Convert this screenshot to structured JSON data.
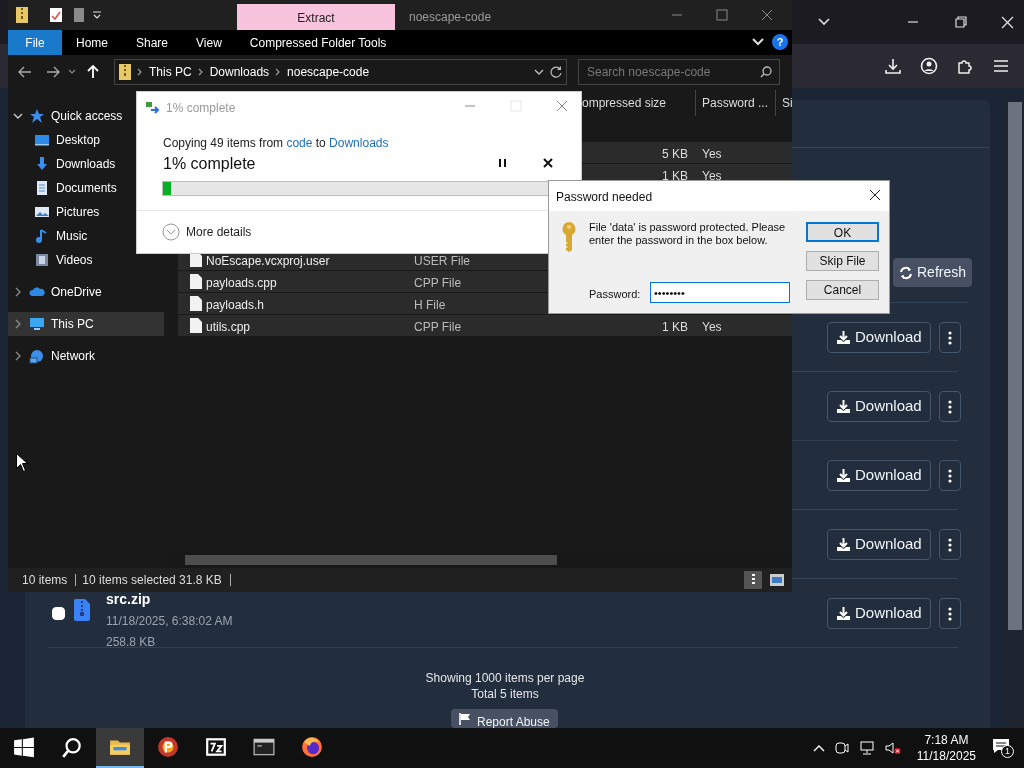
{
  "browser": {
    "refresh": "Refresh",
    "files": [
      {
        "download": "Download"
      },
      {
        "download": "Download"
      },
      {
        "download": "Download"
      },
      {
        "download": "Download"
      },
      {
        "download": "Download",
        "name": "src.zip",
        "date": "11/18/2025, 6:38:02 AM",
        "size": "258.8 KB",
        "checked": false
      }
    ],
    "showing": "Showing 1000 items per page",
    "total": "Total 5 items",
    "report": "Report Abuse"
  },
  "explorer": {
    "context_tab": "Extract",
    "title": "noescape-code",
    "ribbon_tabs": [
      {
        "label": "File",
        "selected": true
      },
      {
        "label": "Home",
        "selected": false
      },
      {
        "label": "Share",
        "selected": false
      },
      {
        "label": "View",
        "selected": false
      },
      {
        "label": "Compressed Folder Tools",
        "selected": false
      }
    ],
    "help": "?",
    "breadcrumb": [
      "This PC",
      "Downloads",
      "noescape-code"
    ],
    "search": {
      "placeholder": "Search noescape-code"
    },
    "nav": [
      {
        "label": "Quick access",
        "expanded": true,
        "selected": false,
        "children": [
          {
            "label": "Desktop"
          },
          {
            "label": "Downloads"
          },
          {
            "label": "Documents"
          },
          {
            "label": "Pictures"
          },
          {
            "label": "Music"
          },
          {
            "label": "Videos"
          }
        ]
      },
      {
        "label": "OneDrive",
        "expanded": false,
        "selected": false
      },
      {
        "label": "This PC",
        "expanded": false,
        "selected": true
      },
      {
        "label": "Network",
        "expanded": false,
        "selected": false
      }
    ],
    "columns": [
      "ompressed size",
      "Password ...",
      "Si"
    ],
    "rows": [
      {
        "size": "5 KB",
        "password": "Yes"
      },
      {
        "size": "1 KB",
        "password": "Yes"
      },
      {
        "name": "NoEscape.vcxproj.user",
        "type": "USER File"
      },
      {
        "name": "payloads.cpp",
        "type": "CPP File"
      },
      {
        "name": "payloads.h",
        "type": "H File"
      },
      {
        "name": "utils.cpp",
        "type": "CPP File",
        "size": "1 KB",
        "password": "Yes"
      }
    ],
    "status": {
      "count": "10 items",
      "selection": "10 items selected 31.8 KB"
    }
  },
  "copy_dialog": {
    "title": "1% complete",
    "prefix": "Copying 49 items from",
    "source": "code",
    "middle": "to",
    "destination": "Downloads",
    "heading": "1% complete",
    "level": 0.02,
    "more": "More details"
  },
  "password_dialog": {
    "title": "Password needed",
    "message": "File 'data' is password protected.  Please enter the password in the box below.",
    "label": "Password:",
    "value": "••••••••",
    "buttons": [
      {
        "label": "OK",
        "default": true
      },
      {
        "label": "Skip File",
        "default": false
      },
      {
        "label": "Cancel",
        "default": false
      }
    ]
  },
  "taskbar": {
    "apps": [
      {
        "kind": "start",
        "active": false
      },
      {
        "kind": "search",
        "active": false
      },
      {
        "kind": "explorer",
        "active": true
      },
      {
        "kind": "app",
        "active": false
      },
      {
        "kind": "archiver",
        "active": false
      },
      {
        "kind": "terminal",
        "active": false
      },
      {
        "kind": "browser",
        "active": false
      }
    ],
    "time": "7:18 AM",
    "date": "11/18/2025",
    "notifications": "1"
  }
}
